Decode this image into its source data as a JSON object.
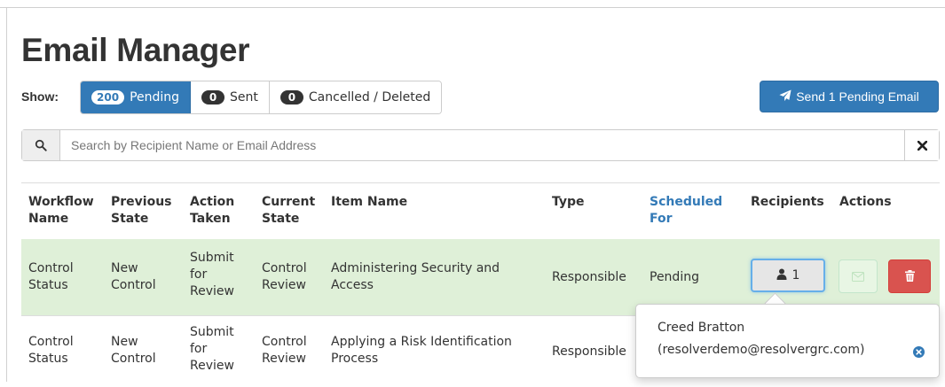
{
  "page": {
    "title": "Email Manager"
  },
  "filters": {
    "show_label": "Show:",
    "pending": {
      "count": "200",
      "label": "Pending"
    },
    "sent": {
      "count": "0",
      "label": "Sent"
    },
    "cancelled": {
      "count": "0",
      "label": "Cancelled / Deleted"
    }
  },
  "send_button": {
    "label": "Send 1 Pending Email",
    "icon": "paper-plane-icon"
  },
  "search": {
    "placeholder": "Search by Recipient Name or Email Address",
    "value": "",
    "icon": "search-icon",
    "clear_icon": "close-icon"
  },
  "table": {
    "headers": {
      "workflow_name": [
        "Workflow",
        "Name"
      ],
      "previous_state": [
        "Previous",
        "State"
      ],
      "action_taken": [
        "Action",
        "Taken"
      ],
      "current_state": [
        "Current",
        "State"
      ],
      "item_name": "Item Name",
      "type": "Type",
      "scheduled_for": [
        "Scheduled",
        "For"
      ],
      "recipients": "Recipients",
      "actions": "Actions"
    },
    "rows": [
      {
        "workflow_name": [
          "Control",
          "Status"
        ],
        "previous_state": [
          "New",
          "Control"
        ],
        "action_taken": [
          "Submit",
          "for",
          "Review"
        ],
        "current_state": [
          "Control",
          "Review"
        ],
        "item_name": [
          "Administering Security and",
          "Access"
        ],
        "type": "Responsible",
        "scheduled_for": "Pending",
        "recipients_count": "1"
      },
      {
        "workflow_name": [
          "Control",
          "Status"
        ],
        "previous_state": [
          "New",
          "Control"
        ],
        "action_taken": [
          "Submit",
          "for",
          "Review"
        ],
        "current_state": [
          "Control",
          "Review"
        ],
        "item_name": [
          "Applying a Risk Identification",
          "Process"
        ],
        "type": "Responsible"
      }
    ]
  },
  "popover": {
    "recipient_name": "Creed Bratton",
    "recipient_email": "(resolverdemo@resolvergrc.com)"
  },
  "colors": {
    "primary": "#337ab7",
    "success_row": "#dff0d8",
    "danger": "#d9534f"
  }
}
